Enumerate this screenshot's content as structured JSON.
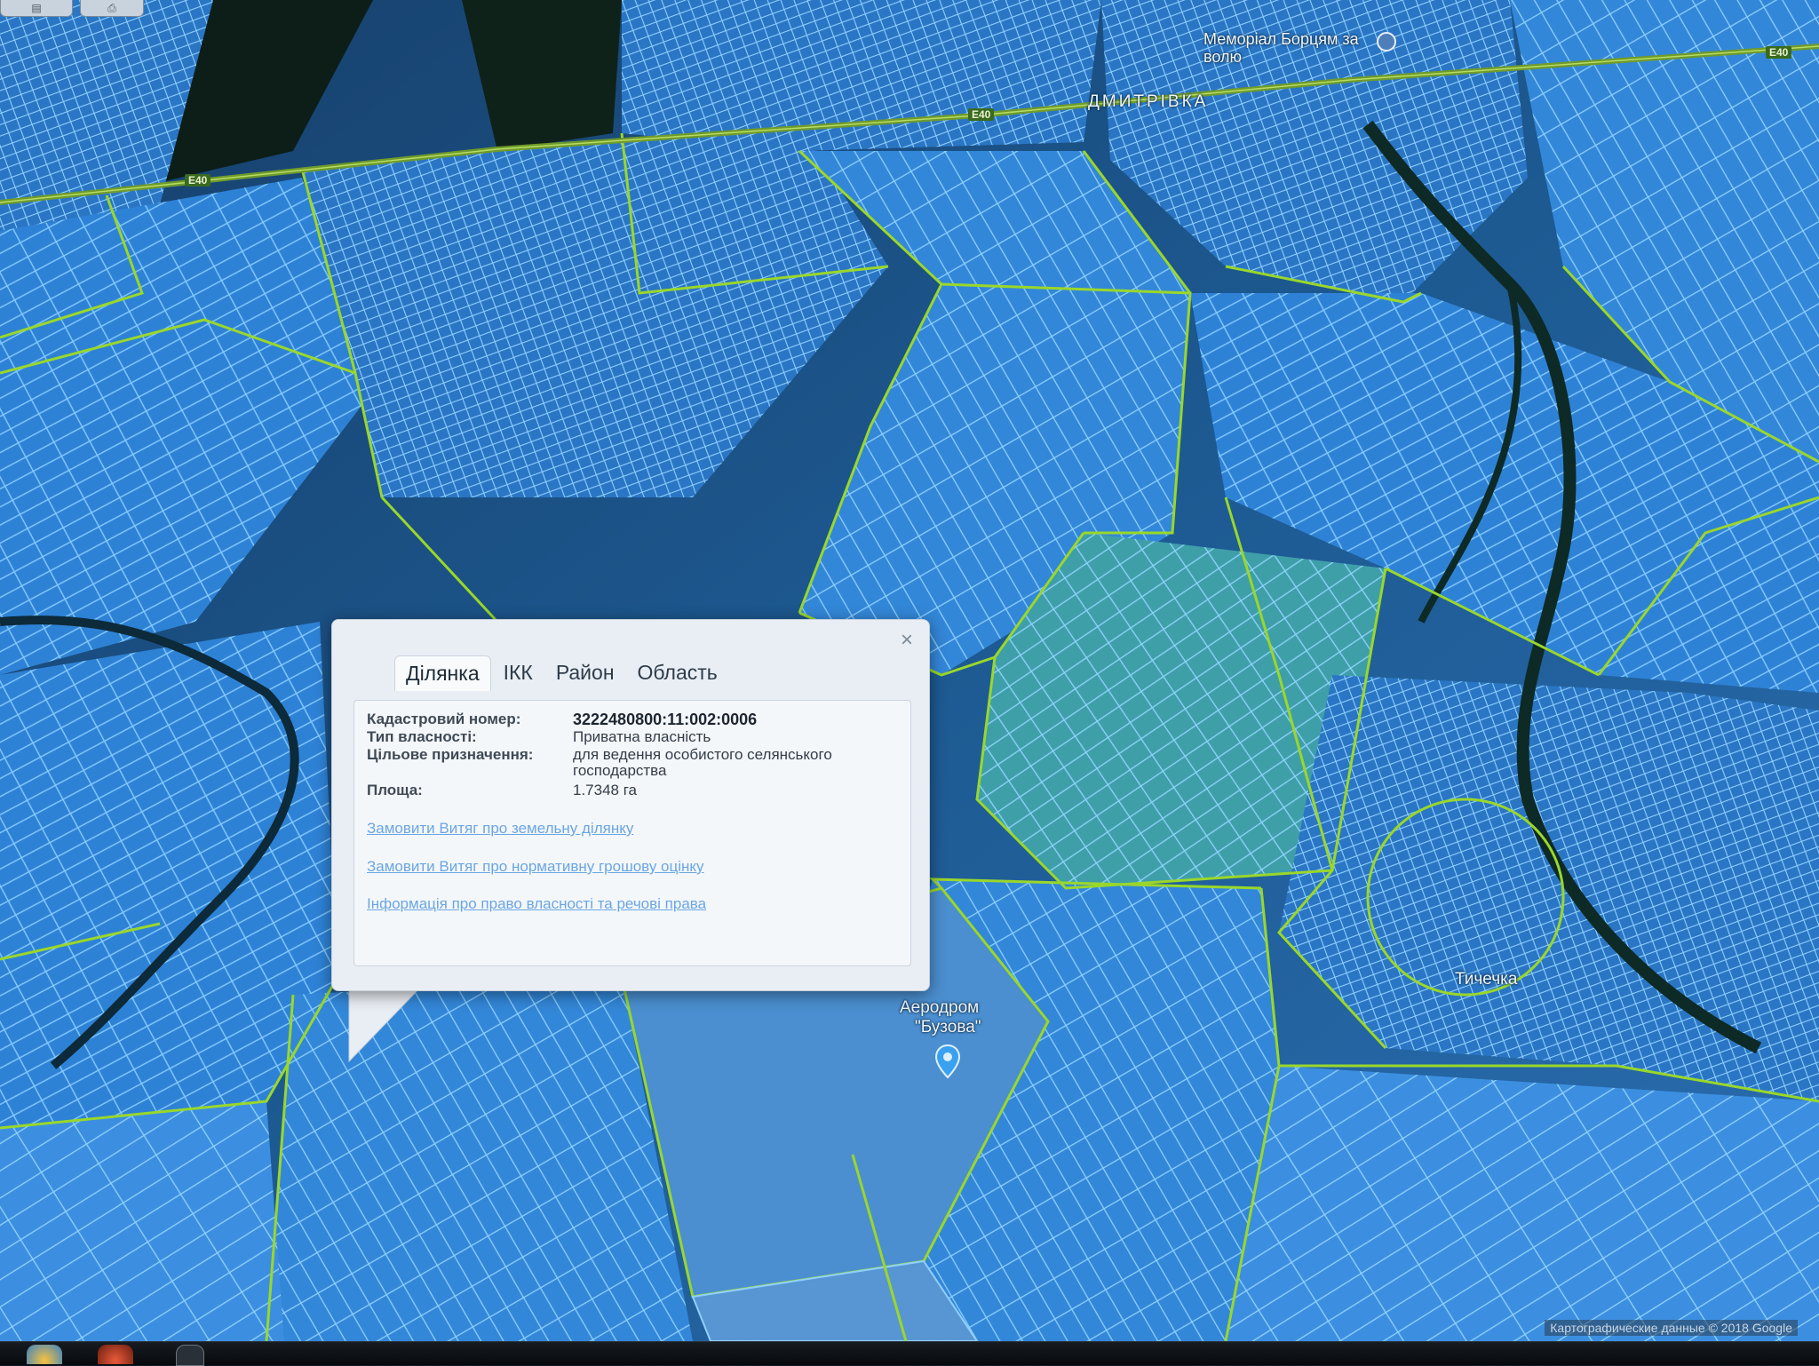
{
  "popup": {
    "tabs": [
      {
        "label": "Ділянка",
        "active": true
      },
      {
        "label": "ІКК",
        "active": false
      },
      {
        "label": "Район",
        "active": false
      },
      {
        "label": "Область",
        "active": false
      }
    ],
    "close_label": "×",
    "fields": [
      {
        "label": "Кадастровий номер:",
        "value": "3222480800:11:002:0006"
      },
      {
        "label": "Тип власності:",
        "value": "Приватна власність"
      },
      {
        "label": "Цільове призначення:",
        "value": "для ведення особистого селянського господарства"
      },
      {
        "label": "Площа:",
        "value": "1.7348 га"
      }
    ],
    "links": [
      "Замовити Витяг про земельну ділянку",
      "Замовити Витяг про нормативну грошову оцінку",
      "Інформація про право власності та речові права"
    ]
  },
  "map": {
    "labels": {
      "memorial": "Меморіал Борцям за волю",
      "village_top": "ДМИТРІВКА",
      "airfield_line1": "Аеродром",
      "airfield_line2": "\"Бузова\"",
      "village_right": "Тичечка"
    },
    "road_labels": [
      "E40",
      "E40",
      "E40"
    ],
    "attribution": "Картографические данные © 2018 Google",
    "colors": {
      "parcel_stroke": "#7fc7ff",
      "parcel_fill": "#2f7fd0",
      "boundary_green": "#9ad72a",
      "road_green": "#6f9a2c"
    }
  }
}
